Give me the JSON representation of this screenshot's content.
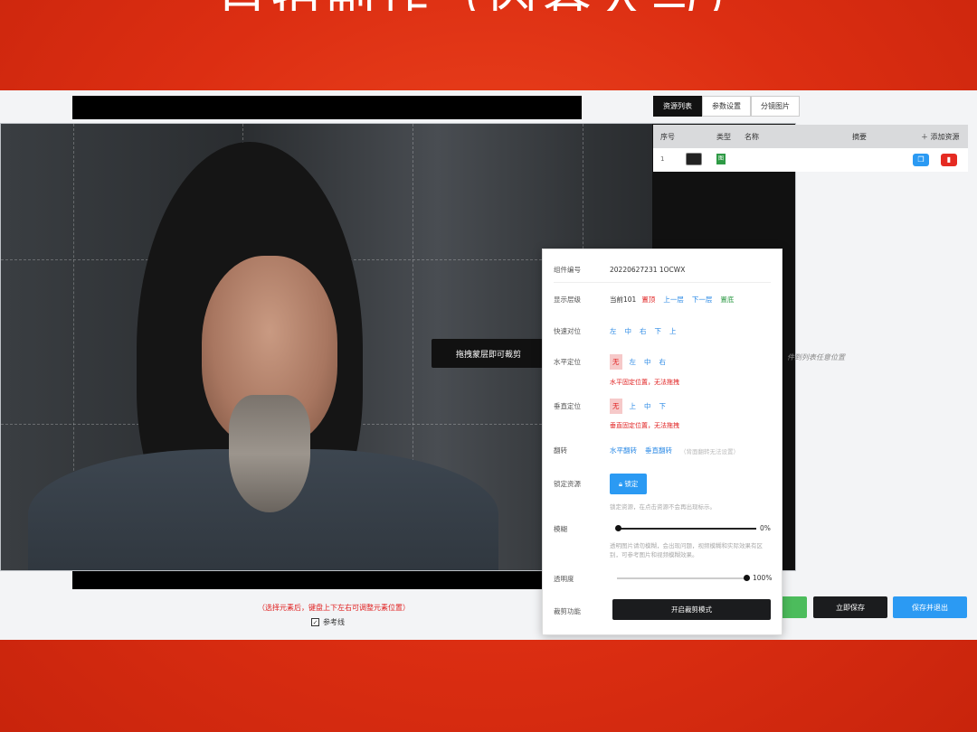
{
  "banner": {
    "title": "自拍制作（内容人与）"
  },
  "editor": {
    "crop_tip": "拖拽蒙层即可裁剪",
    "hint": "（选择元素后，键盘上下左右可调整元素位置）",
    "ref_line_label": "参考线",
    "ref_line_checked": true
  },
  "panel": {
    "tabs": [
      {
        "label": "资源列表",
        "active": true
      },
      {
        "label": "参数设置",
        "active": false
      },
      {
        "label": "分镜图片",
        "active": false
      }
    ],
    "table_headers": {
      "index": "序号",
      "type": "类型",
      "name": "名称",
      "summary": "摘要",
      "add": "＋ 添加资源"
    },
    "row": {
      "index": "1",
      "type_tag": "图"
    },
    "drop_hint": "件到列表任意位置",
    "buttons": {
      "save_now": "立即保存",
      "save_exit": "保存并退出"
    }
  },
  "props": {
    "component_id_label": "组件编号",
    "component_id": "20220627231 1OCWX",
    "layer_label": "显示层级",
    "layer_current": "当前101",
    "layer_top": "置顶",
    "layer_up": "上一层",
    "layer_down": "下一层",
    "layer_bottom": "置底",
    "quick_label": "快速对位",
    "quick_items": [
      "左",
      "中",
      "右",
      "下",
      "上"
    ],
    "h_label": "水平定位",
    "h_items": [
      "无",
      "左",
      "中",
      "右"
    ],
    "h_warn": "水平固定位置，无法拖拽",
    "v_label": "垂直定位",
    "v_items": [
      "无",
      "上",
      "中",
      "下"
    ],
    "v_warn": "垂直固定位置，无法拖拽",
    "flip_label": "翻转",
    "flip_h": "水平翻转",
    "flip_v": "垂直翻转",
    "flip_note": "（背面翻转无法设置）",
    "lock_label": "锁定资源",
    "lock_btn": "锁定",
    "lock_note": "锁定资源，在点击资源不会再出现标示。",
    "blur_label": "模糊",
    "blur_value": "0%",
    "blur_fraction": 0,
    "blur_note": "透明图片请勿模糊，会出现问题，视频模糊和实际效果有区别，可参考图片和视频模糊效果。",
    "opacity_label": "透明度",
    "opacity_value": "100%",
    "opacity_fraction": 1,
    "crop_label": "裁剪功能",
    "crop_btn": "开启裁剪模式"
  },
  "colors": {
    "banner": "#e53a1c",
    "accent_blue": "#2b9af3",
    "danger": "#e02020",
    "green": "#2e9a45"
  }
}
